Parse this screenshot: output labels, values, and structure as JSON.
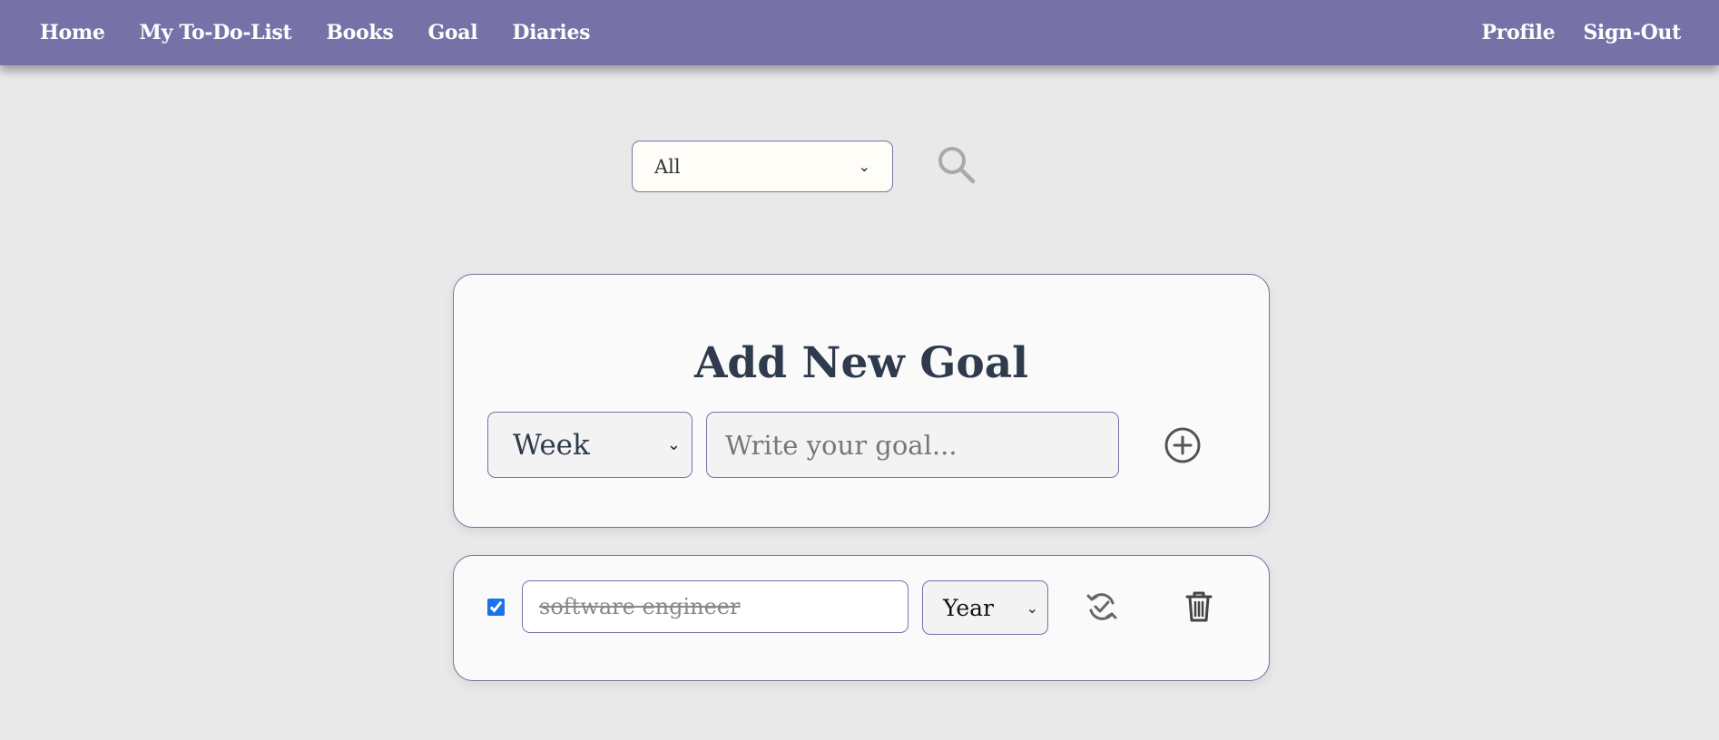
{
  "nav": {
    "left": [
      {
        "label": "Home"
      },
      {
        "label": "My To-Do-List"
      },
      {
        "label": "Books"
      },
      {
        "label": "Goal"
      },
      {
        "label": "Diaries"
      }
    ],
    "right": [
      {
        "label": "Profile"
      },
      {
        "label": "Sign-Out"
      }
    ]
  },
  "filter": {
    "selected": "All",
    "search_icon": "search-icon"
  },
  "add_goal": {
    "title": "Add New Goal",
    "period_selected": "Week",
    "input_placeholder": "Write your goal...",
    "input_value": "",
    "add_icon": "plus-circle-icon"
  },
  "goals": [
    {
      "done": true,
      "text": "software engineer",
      "period": "Year",
      "update_icon": "refresh-check-icon",
      "delete_icon": "trash-icon"
    }
  ],
  "colors": {
    "navbar": "#7672a8",
    "background": "#e9e9e9",
    "card_border": "#7672a8",
    "title": "#2f3b4c",
    "checkbox": "#1a73e8"
  }
}
